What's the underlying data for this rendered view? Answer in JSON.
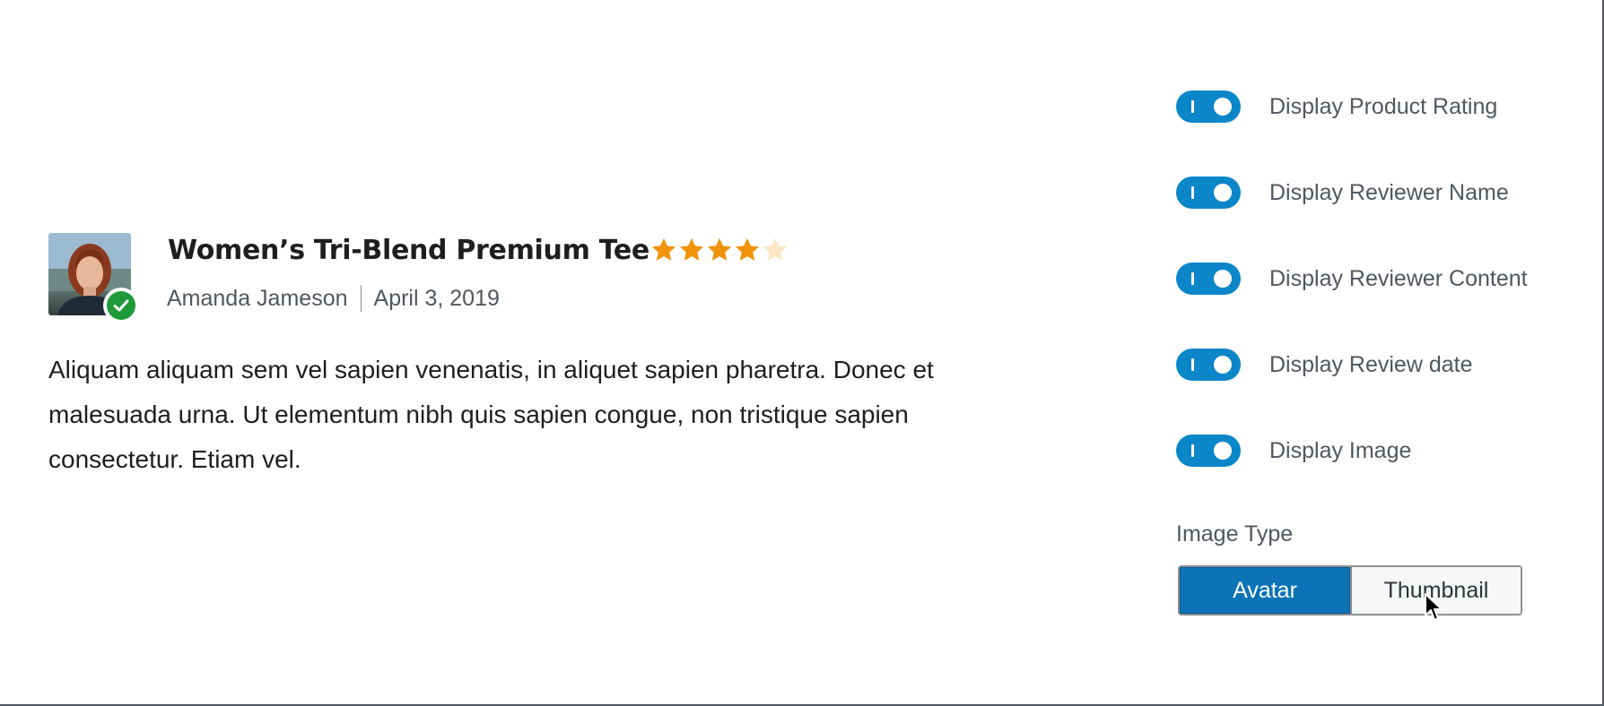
{
  "review": {
    "title": "Women’s Tri-Blend Premium Tee",
    "rating": 4,
    "rating_max": 5,
    "reviewer_name": "Amanda Jameson",
    "date": "April 3, 2019",
    "body": "Aliquam aliquam sem vel sapien venenatis, in aliquet sapien pharetra. Donec et malesuada urna. Ut elementum nibh quis sapien congue, non tristique sapien consectetur. Etiam vel.",
    "verified": true
  },
  "settings": {
    "toggles": [
      {
        "label": "Display Product Rating",
        "on": true
      },
      {
        "label": "Display Reviewer Name",
        "on": true
      },
      {
        "label": "Display Reviewer Content",
        "on": true
      },
      {
        "label": "Display Review date",
        "on": true
      },
      {
        "label": "Display Image",
        "on": true
      }
    ],
    "image_type": {
      "label": "Image Type",
      "options": [
        "Avatar",
        "Thumbnail"
      ],
      "selected": "Avatar"
    }
  },
  "colors": {
    "toggle_on": "#0b86c9",
    "star_filled": "#f0930a",
    "star_empty": "#fce6c4",
    "segment_active": "#0b73b6",
    "verified": "#1e9a3a"
  },
  "icons": {
    "verified": "check-circle-icon",
    "star": "star-icon",
    "cursor": "pointer-cursor-icon"
  }
}
